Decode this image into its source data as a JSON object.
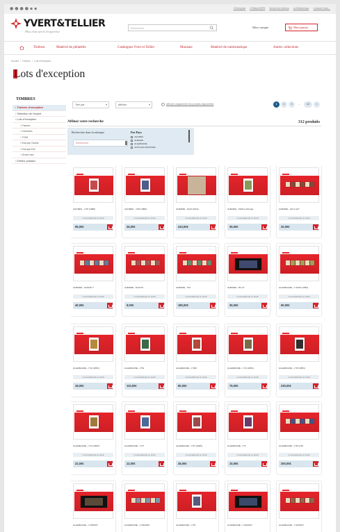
{
  "colors": {
    "brand_red": "#d6232a",
    "nav_red": "#c2262e",
    "price_bar": "#d9e6ef",
    "filter_bg": "#dfeaf2",
    "pager_active": "#1c5d8c"
  },
  "header": {
    "social_icons": [
      "facebook-icon",
      "twitter-icon",
      "pinterest-icon",
      "instagram-icon",
      "youtube-icon",
      "newsletter-icon"
    ],
    "top_links": [
      "L'Entreprise",
      "L'Éditeur/IMPR",
      "Vendre aux timbres",
      "La Bibliothèque",
      "Contacte Votre..."
    ],
    "logo": "YVERT&TELLIER",
    "tagline": "Plus d'un siècle d'expertise",
    "search_placeholder": "Recherche",
    "account": "Mon compte",
    "cart": "Mon panier"
  },
  "nav": [
    "Timbres",
    "Matériel de philatélie",
    "Catalogues Yvert et Tellier",
    "Monnaie",
    "Matériel de numismatique",
    "Autres collections"
  ],
  "breadcrumb": [
    "Accueil",
    "Timbres",
    "Lots d'exception"
  ],
  "page_title": "Lots d'exception",
  "sidebar": {
    "heading": "TIMBRES",
    "items": [
      {
        "label": "Timbres d'exception",
        "active": true
      },
      {
        "label": "Sélection de l'expert"
      },
      {
        "label": "Lots d'exception"
      },
      {
        "label": "France",
        "indent": true
      },
      {
        "label": "Colonies",
        "indent": true
      },
      {
        "label": "TOM",
        "indent": true
      },
      {
        "label": "Europe Ouest",
        "indent": true
      },
      {
        "label": "Europe Est",
        "indent": true
      },
      {
        "label": "Outre mer",
        "indent": true
      },
      {
        "label": "Entiers postaux"
      }
    ]
  },
  "toolbar": {
    "sort": "Trier par",
    "per_page": "Afficher",
    "in_stock_label": "Afficher uniquement les produits disponibles",
    "pages": [
      "1",
      "2",
      "3",
      "...",
      "13",
      ">"
    ]
  },
  "refine": {
    "title": "Affinez votre recherche",
    "count": "312 produits",
    "search_label": "Rechercher dans la rubrique",
    "search_placeholder": "Rechercher",
    "country_label": "Par Pays",
    "countries": [
      "AÇORES",
      "ALBANIE",
      "ALLEMAGNE",
      "ANTILLES DANOISES"
    ]
  },
  "products": [
    {
      "name": "AÇORES - n°15 (1868)",
      "stock": "1 exemplaire(s) en stock",
      "price": "55,00€",
      "img": "stamp",
      "tone": "#c44b4b"
    },
    {
      "name": "AÇORES - n°48 (1880)",
      "stock": "1 exemplaire(s) en stock",
      "price": "25,00€",
      "img": "stamp",
      "tone": "#4f5d8a"
    },
    {
      "name": "ALBANIE - 1913 (1913)",
      "stock": "1 exemplaire(s) en stock",
      "price": "410,00€",
      "img": "cover",
      "tone": "#c9b49a"
    },
    {
      "name": "ALBANIE - 1928 surcharge",
      "stock": "1 exemplaire(s) en stock",
      "price": "35,00€",
      "img": "stamp",
      "tone": "#8a9a5b"
    },
    {
      "name": "ALBANIE - 123 à 127",
      "stock": "1 exemplaire(s) en stock",
      "price": "20,00€",
      "img": "row",
      "tone": "#7c4f3a"
    },
    {
      "name": "ALBANIE - 143/146 **",
      "stock": "1 exemplaire(s) en stock",
      "price": "40,00€",
      "img": "row",
      "tone": "#5a7fa0"
    },
    {
      "name": "ALBANIE - 161/170",
      "stock": "1 exemplaire(s) en stock",
      "price": "9,00€",
      "img": "row",
      "tone": "#a05a5a"
    },
    {
      "name": "ALBANIE - 373",
      "stock": "1 exemplaire(s) en stock",
      "price": "180,00€",
      "img": "row",
      "tone": "#6a8a6a"
    },
    {
      "name": "ALBANIE - PA 1/7",
      "stock": "1 exemplaire(s) en stock",
      "price": "35,00€",
      "img": "block",
      "tone": "#3f4a6e"
    },
    {
      "name": "ALLEMAGNE - n°14/15 (1851)",
      "stock": "1 exemplaire(s) en stock",
      "price": "60,00€",
      "img": "row",
      "tone": "#9aa35a"
    },
    {
      "name": "ALLEMAGNE - n°12 (1851)",
      "stock": "1 exemplaire(s) en stock",
      "price": "18,00€",
      "img": "stamp",
      "tone": "#b58a3a"
    },
    {
      "name": "ALLEMAGNE - n°52",
      "stock": "1 exemplaire(s) en stock",
      "price": "110,00€",
      "img": "stamp",
      "tone": "#3a6a4a"
    },
    {
      "name": "ALLEMAGNE - n°290",
      "stock": "1 exemplaire(s) en stock",
      "price": "80,00€",
      "img": "stamp",
      "tone": "#b04a3a"
    },
    {
      "name": "ALLEMAGNE - n°14 (1851)",
      "stock": "1 exemplaire(s) en stock",
      "price": "75,00€",
      "img": "stamp",
      "tone": "#7a6a4a"
    },
    {
      "name": "ALLEMAGNE - n°15 (1851)",
      "stock": "1 exemplaire(s) en stock",
      "price": "230,00€",
      "img": "stamp",
      "tone": "#2f2f2f"
    },
    {
      "name": "ALLEMAGNE - n°21 (1863)",
      "stock": "1 exemplaire(s) en stock",
      "price": "22,00€",
      "img": "stamp",
      "tone": "#a07a3a"
    },
    {
      "name": "ALLEMAGNE - n°27",
      "stock": "1 exemplaire(s) en stock",
      "price": "12,00€",
      "img": "stamp",
      "tone": "#4a6a9a"
    },
    {
      "name": "ALLEMAGNE - n°97 (1905)",
      "stock": "1 exemplaire(s) en stock",
      "price": "28,00€",
      "img": "stamp",
      "tone": "#9a4a4a"
    },
    {
      "name": "ALLEMAGNE - n°5",
      "stock": "1 exemplaire(s) en stock",
      "price": "10,00€",
      "img": "stamp",
      "tone": "#6a3a6a"
    },
    {
      "name": "ALLEMAGNE - n°53 à 56",
      "stock": "1 exemplaire(s) en stock",
      "price": "200,00€",
      "img": "row",
      "tone": "#3a5a8a"
    },
    {
      "name": "ALLEMAGNE - n°105/107",
      "stock": "1 exemplaire(s) en stock",
      "price": "",
      "img": "block",
      "tone": "#5a4a3a"
    },
    {
      "name": "ALLEMAGNE - n°184/195",
      "stock": "1 exemplaire(s) en stock",
      "price": "",
      "img": "row",
      "tone": "#7a9aaa"
    },
    {
      "name": "ALLEMAGNE - n°P1",
      "stock": "1 exemplaire(s) en stock",
      "price": "",
      "img": "stamp",
      "tone": "#5a5a7a"
    },
    {
      "name": "ALLEMAGNE - n°423/427",
      "stock": "1 exemplaire(s) en stock",
      "price": "",
      "img": "block",
      "tone": "#3a4a6a"
    },
    {
      "name": "ALLEMAGNE - n°433/437",
      "stock": "1 exemplaire(s) en stock",
      "price": "",
      "img": "row",
      "tone": "#8a6a4a"
    }
  ]
}
